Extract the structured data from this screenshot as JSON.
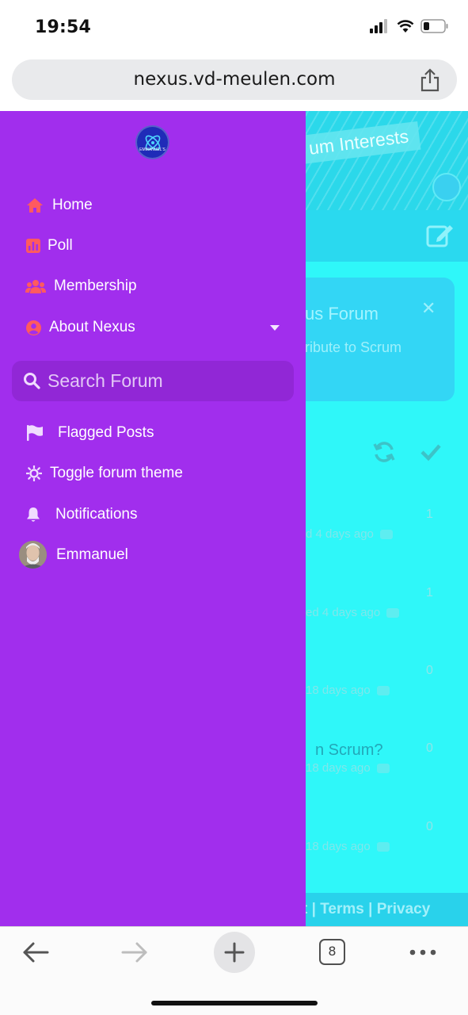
{
  "status_bar": {
    "time": "19:54"
  },
  "browser": {
    "url": "nexus.vd-meulen.com",
    "tab_count": "8"
  },
  "background_page": {
    "header_banner": "um Interests",
    "notice_title": "us Forum",
    "notice_subtitle": "ribute to Scrum",
    "topics": [
      {
        "title": "",
        "meta": "d 4 days ago",
        "count": "1"
      },
      {
        "title": "",
        "meta": "ed 4 days ago",
        "count": "1"
      },
      {
        "title": "",
        "meta": "18 days ago",
        "count": "0"
      },
      {
        "title": "n Scrum?",
        "meta": "18 days ago",
        "count": "0"
      },
      {
        "title": "",
        "meta": "18 days ago",
        "count": "0"
      }
    ],
    "footer": "t | Terms | Privacy"
  },
  "drawer": {
    "logo_text": "EMMANUEL'S",
    "nav": [
      {
        "label": "Home",
        "icon": "home-icon"
      },
      {
        "label": "Poll",
        "icon": "poll-icon"
      },
      {
        "label": "Membership",
        "icon": "users-icon"
      },
      {
        "label": "About Nexus",
        "icon": "user-circle-icon"
      }
    ],
    "search": {
      "placeholder": "Search Forum"
    },
    "secondary": [
      {
        "label": "Flagged Posts",
        "icon": "flag-icon"
      },
      {
        "label": "Toggle forum theme",
        "icon": "sun-icon"
      },
      {
        "label": "Notifications",
        "icon": "bell-icon"
      },
      {
        "label": "Emmanuel",
        "icon": "avatar"
      }
    ]
  },
  "colors": {
    "drawer_bg": "#a12eed",
    "accent_icon": "#ff5a5f",
    "page_overlay": "#2ff7f9"
  }
}
